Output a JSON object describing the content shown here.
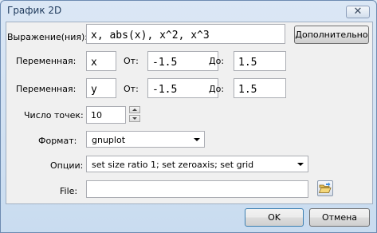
{
  "window": {
    "title": "График 2D",
    "close_glyph": "✕"
  },
  "expression": {
    "label": "Выражение(ния):",
    "value": "x, abs(x), x^2, x^3",
    "more_button": "Дополнительно"
  },
  "variables": [
    {
      "label": "Переменная:",
      "name": "x",
      "from_label": "От:",
      "from": "-1.5",
      "to_label": "До:",
      "to": "1.5"
    },
    {
      "label": "Переменная:",
      "name": "y",
      "from_label": "От:",
      "from": "-1.5",
      "to_label": "До:",
      "to": "1.5"
    }
  ],
  "points": {
    "label": "Число точек:",
    "value": "10"
  },
  "format": {
    "label": "Формат:",
    "selected": "gnuplot"
  },
  "options": {
    "label": "Опции:",
    "selected": "set size ratio 1; set zeroaxis; set grid"
  },
  "file": {
    "label": "File:",
    "value": ""
  },
  "buttons": {
    "ok": "OK",
    "cancel": "Отмена"
  },
  "icons": {
    "browse": "folder-open-icon"
  }
}
